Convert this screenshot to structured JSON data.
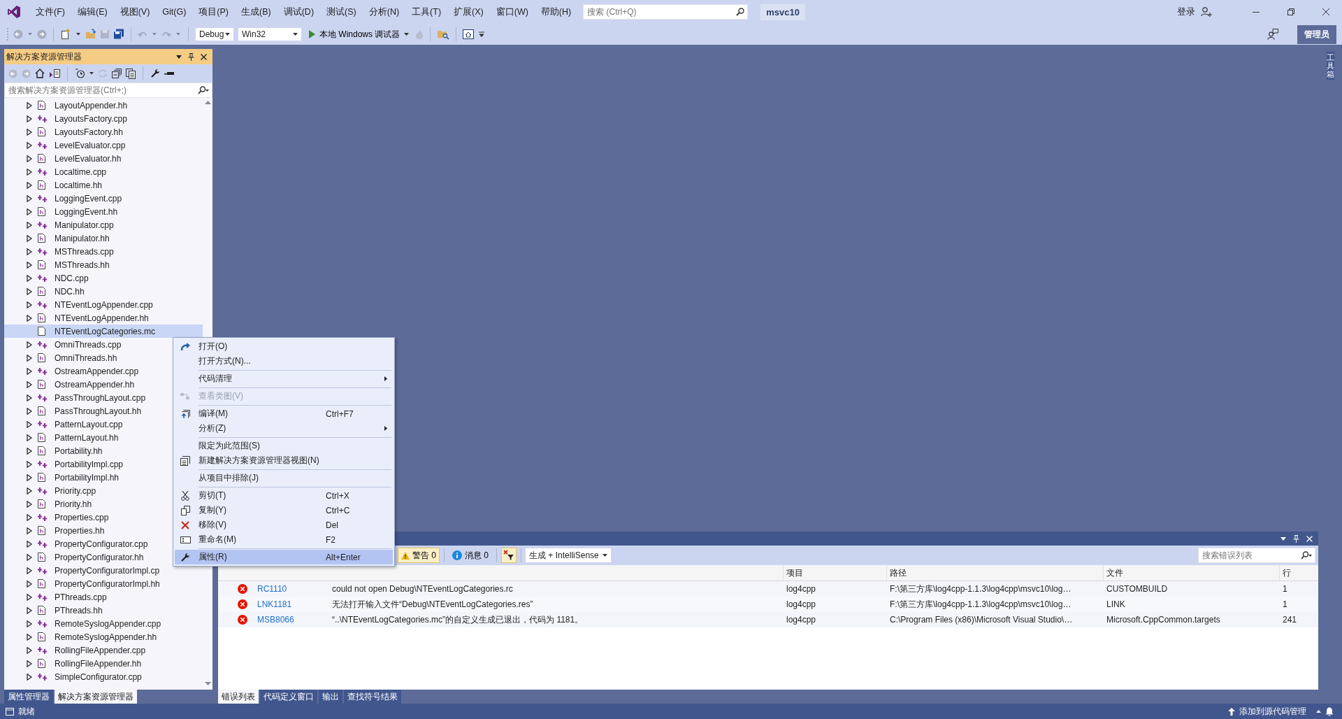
{
  "menu_bar": {
    "items": [
      "文件(F)",
      "编辑(E)",
      "视图(V)",
      "Git(G)",
      "项目(P)",
      "生成(B)",
      "调试(D)",
      "测试(S)",
      "分析(N)",
      "工具(T)",
      "扩展(X)",
      "窗口(W)",
      "帮助(H)"
    ],
    "search": {
      "placeholder": "搜索 (Ctrl+Q)"
    },
    "solution_name": "msvc10",
    "sign_in": "登录"
  },
  "toolbar": {
    "configuration": "Debug",
    "platform": "Win32",
    "debugger": "本地 Windows 调试器",
    "admin_badge": "管理员"
  },
  "solution_explorer": {
    "title": "解决方案资源管理器",
    "search": {
      "placeholder": "搜索解决方案资源管理器(Ctrl+;)"
    },
    "items": [
      {
        "name": "LayoutAppender.hh",
        "kind": "header",
        "expanded": false,
        "selected": false
      },
      {
        "name": "LayoutsFactory.cpp",
        "kind": "source",
        "expanded": false,
        "selected": false
      },
      {
        "name": "LayoutsFactory.hh",
        "kind": "header",
        "expanded": false,
        "selected": false
      },
      {
        "name": "LevelEvaluator.cpp",
        "kind": "source",
        "expanded": false,
        "selected": false
      },
      {
        "name": "LevelEvaluator.hh",
        "kind": "header",
        "expanded": false,
        "selected": false
      },
      {
        "name": "Localtime.cpp",
        "kind": "source",
        "expanded": false,
        "selected": false
      },
      {
        "name": "Localtime.hh",
        "kind": "header",
        "expanded": false,
        "selected": false
      },
      {
        "name": "LoggingEvent.cpp",
        "kind": "source",
        "expanded": false,
        "selected": false
      },
      {
        "name": "LoggingEvent.hh",
        "kind": "header",
        "expanded": false,
        "selected": false
      },
      {
        "name": "Manipulator.cpp",
        "kind": "source",
        "expanded": false,
        "selected": false
      },
      {
        "name": "Manipulator.hh",
        "kind": "header",
        "expanded": false,
        "selected": false
      },
      {
        "name": "MSThreads.cpp",
        "kind": "source",
        "expanded": false,
        "selected": false
      },
      {
        "name": "MSThreads.hh",
        "kind": "header",
        "expanded": false,
        "selected": false
      },
      {
        "name": "NDC.cpp",
        "kind": "source",
        "expanded": false,
        "selected": false
      },
      {
        "name": "NDC.hh",
        "kind": "header",
        "expanded": false,
        "selected": false
      },
      {
        "name": "NTEventLogAppender.cpp",
        "kind": "source",
        "expanded": false,
        "selected": false
      },
      {
        "name": "NTEventLogAppender.hh",
        "kind": "header",
        "expanded": false,
        "selected": false
      },
      {
        "name": "NTEventLogCategories.mc",
        "kind": "file",
        "selected": true
      },
      {
        "name": "OmniThreads.cpp",
        "kind": "source",
        "expanded": false,
        "selected": false
      },
      {
        "name": "OmniThreads.hh",
        "kind": "header",
        "expanded": false,
        "selected": false
      },
      {
        "name": "OstreamAppender.cpp",
        "kind": "source",
        "expanded": false,
        "selected": false
      },
      {
        "name": "OstreamAppender.hh",
        "kind": "header",
        "expanded": false,
        "selected": false
      },
      {
        "name": "PassThroughLayout.cpp",
        "kind": "source",
        "expanded": false,
        "selected": false
      },
      {
        "name": "PassThroughLayout.hh",
        "kind": "header",
        "expanded": false,
        "selected": false
      },
      {
        "name": "PatternLayout.cpp",
        "kind": "source",
        "expanded": false,
        "selected": false
      },
      {
        "name": "PatternLayout.hh",
        "kind": "header",
        "expanded": false,
        "selected": false
      },
      {
        "name": "Portability.hh",
        "kind": "header",
        "expanded": false,
        "selected": false
      },
      {
        "name": "PortabilityImpl.cpp",
        "kind": "source",
        "expanded": false,
        "selected": false
      },
      {
        "name": "PortabilityImpl.hh",
        "kind": "header",
        "expanded": false,
        "selected": false
      },
      {
        "name": "Priority.cpp",
        "kind": "source",
        "expanded": false,
        "selected": false
      },
      {
        "name": "Priority.hh",
        "kind": "header",
        "expanded": false,
        "selected": false
      },
      {
        "name": "Properties.cpp",
        "kind": "source",
        "expanded": false,
        "selected": false
      },
      {
        "name": "Properties.hh",
        "kind": "header",
        "expanded": false,
        "selected": false
      },
      {
        "name": "PropertyConfigurator.cpp",
        "kind": "source",
        "expanded": false,
        "selected": false
      },
      {
        "name": "PropertyConfigurator.hh",
        "kind": "header",
        "expanded": false,
        "selected": false
      },
      {
        "name": "PropertyConfiguratorImpl.cp",
        "kind": "source",
        "expanded": false,
        "selected": false
      },
      {
        "name": "PropertyConfiguratorImpl.hh",
        "kind": "header",
        "expanded": false,
        "selected": false
      },
      {
        "name": "PThreads.cpp",
        "kind": "source",
        "expanded": false,
        "selected": false
      },
      {
        "name": "PThreads.hh",
        "kind": "header",
        "expanded": false,
        "selected": false
      },
      {
        "name": "RemoteSyslogAppender.cpp",
        "kind": "source",
        "expanded": false,
        "selected": false
      },
      {
        "name": "RemoteSyslogAppender.hh",
        "kind": "header",
        "expanded": false,
        "selected": false
      },
      {
        "name": "RollingFileAppender.cpp",
        "kind": "source",
        "expanded": false,
        "selected": false
      },
      {
        "name": "RollingFileAppender.hh",
        "kind": "header",
        "expanded": false,
        "selected": false
      },
      {
        "name": "SimpleConfigurator.cpp",
        "kind": "source",
        "expanded": false,
        "selected": false
      }
    ],
    "tabs": [
      {
        "label": "属性管理器",
        "selected": false
      },
      {
        "label": "解决方案资源管理器",
        "selected": true
      }
    ]
  },
  "context_menu": {
    "items": [
      {
        "kind": "open",
        "label": "打开(O)",
        "disabled": false,
        "selected": false
      },
      {
        "kind": "plain",
        "label": "打开方式(N)...",
        "disabled": false,
        "selected": false
      },
      {
        "kind": "separator"
      },
      {
        "kind": "submenu",
        "label": "代码清理",
        "disabled": false,
        "selected": false
      },
      {
        "kind": "separator"
      },
      {
        "kind": "classdiagram",
        "label": "查看类图(V)",
        "disabled": true,
        "selected": false
      },
      {
        "kind": "separator"
      },
      {
        "kind": "compile",
        "label": "编译(M)",
        "shortcut": "Ctrl+F7",
        "disabled": false,
        "selected": false
      },
      {
        "kind": "submenu",
        "label": "分析(Z)",
        "disabled": false,
        "selected": false
      },
      {
        "kind": "separator"
      },
      {
        "kind": "plain",
        "label": "限定为此范围(S)",
        "disabled": false,
        "selected": false
      },
      {
        "kind": "newview",
        "label": "新建解决方案资源管理器视图(N)",
        "disabled": false,
        "selected": false
      },
      {
        "kind": "separator"
      },
      {
        "kind": "plain",
        "label": "从项目中排除(J)",
        "disabled": false,
        "selected": false
      },
      {
        "kind": "separator"
      },
      {
        "kind": "cut",
        "label": "剪切(T)",
        "shortcut": "Ctrl+X",
        "disabled": false,
        "selected": false
      },
      {
        "kind": "copy",
        "label": "复制(Y)",
        "shortcut": "Ctrl+C",
        "disabled": false,
        "selected": false
      },
      {
        "kind": "remove",
        "label": "移除(V)",
        "shortcut": "Del",
        "disabled": false,
        "selected": false
      },
      {
        "kind": "rename",
        "label": "重命名(M)",
        "shortcut": "F2",
        "disabled": false,
        "selected": false
      },
      {
        "kind": "separator"
      },
      {
        "kind": "properties",
        "label": "属性(R)",
        "shortcut": "Alt+Enter",
        "disabled": false,
        "selected": true
      }
    ]
  },
  "error_list": {
    "toolbar": {
      "warnings": "警告 0",
      "messages": "消息 0",
      "scope": "生成 + IntelliSense",
      "search": {
        "placeholder": "搜索错误列表"
      }
    },
    "columns": [
      "项目",
      "路径",
      "文件",
      "行"
    ],
    "rows": [
      {
        "code": "RC1110",
        "description": "could not open Debug\\NTEventLogCategories.rc",
        "project": "log4cpp",
        "path": "F:\\第三方库\\log4cpp-1.1.3\\log4cpp\\msvc10\\log…",
        "file": "CUSTOMBUILD",
        "line": "1"
      },
      {
        "code": "LNK1181",
        "description": "无法打开输入文件“Debug\\NTEventLogCategories.res”",
        "project": "log4cpp",
        "path": "F:\\第三方库\\log4cpp-1.1.3\\log4cpp\\msvc10\\log…",
        "file": "LINK",
        "line": "1"
      },
      {
        "code": "MSB8066",
        "description": "“..\\NTEventLogCategories.mc”的自定义生成已退出，代码为 1181。",
        "project": "log4cpp",
        "path": "C:\\Program Files (x86)\\Microsoft Visual Studio\\…",
        "file": "Microsoft.CppCommon.targets",
        "line": "241"
      }
    ],
    "tabs": [
      {
        "label": "错误列表",
        "selected": true
      },
      {
        "label": "代码定义窗口",
        "selected": false
      },
      {
        "label": "输出",
        "selected": false
      },
      {
        "label": "查找符号结果",
        "selected": false
      }
    ]
  },
  "toolbox_tab": "工具箱",
  "status_bar": {
    "state": "就绪",
    "source_control": "添加到源代码管理"
  }
}
